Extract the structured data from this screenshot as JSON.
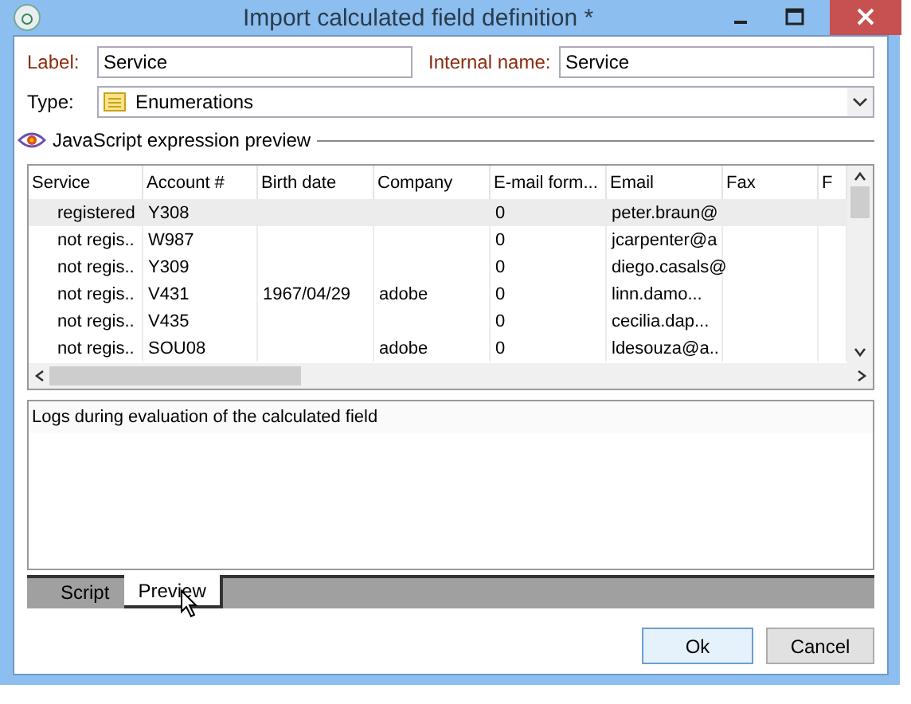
{
  "window": {
    "title": "Import calculated field definition *"
  },
  "form": {
    "label": {
      "caption": "Label:",
      "value": "Service"
    },
    "internal_name": {
      "caption": "Internal name:",
      "value": "Service"
    },
    "type": {
      "caption": "Type:",
      "value": "Enumerations"
    }
  },
  "preview_section": {
    "title": "JavaScript expression preview"
  },
  "table": {
    "columns": [
      "Service",
      "Account #",
      "Birth date",
      "Company",
      "E-mail form...",
      "Email",
      "Fax",
      "F"
    ],
    "rows": [
      {
        "selected": true,
        "cells": [
          "registered",
          "Y308",
          "",
          "",
          "0",
          "peter.braun@",
          ""
        ]
      },
      {
        "selected": false,
        "cells": [
          "not regis..",
          "W987",
          "",
          "",
          "0",
          "jcarpenter@a",
          ""
        ]
      },
      {
        "selected": false,
        "cells": [
          "not regis..",
          "Y309",
          "",
          "",
          "0",
          "diego.casals@",
          ""
        ]
      },
      {
        "selected": false,
        "cells": [
          "not regis..",
          "V431",
          "1967/04/29",
          "adobe",
          "0",
          "linn.damo...",
          ""
        ]
      },
      {
        "selected": false,
        "cells": [
          "not regis..",
          "V435",
          "",
          "",
          "0",
          "cecilia.dap...",
          ""
        ]
      },
      {
        "selected": false,
        "cells": [
          "not regis..",
          "SOU08",
          "",
          "adobe",
          "0",
          "ldesouza@a..",
          ""
        ]
      }
    ]
  },
  "logs": {
    "header": "Logs during evaluation of the calculated field"
  },
  "tabs": [
    {
      "label": "Script",
      "selected": false
    },
    {
      "label": "Preview",
      "selected": true
    }
  ],
  "buttons": [
    {
      "label": "Ok",
      "default": true
    },
    {
      "label": "Cancel",
      "default": false
    }
  ]
}
